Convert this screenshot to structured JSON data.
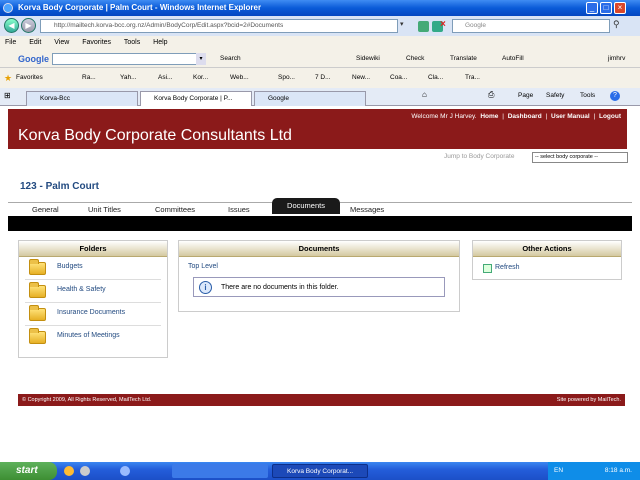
{
  "browser": {
    "window_title": "Korva Body Corporate | Palm Court - Windows Internet Explorer",
    "address": "http://mailtech.korva-bcc.org.nz/Admin/BodyCorp/Edit.aspx?bcid=2#Documents",
    "search_placeholder": "Google",
    "menu": [
      "File",
      "Edit",
      "View",
      "Favorites",
      "Tools",
      "Help"
    ],
    "google_toolbar": {
      "logo": "Google",
      "search": "Search",
      "sidewiki": "Sidewiki",
      "check": "Check",
      "translate": "Translate",
      "autofill": "AutoFill",
      "user": "jimhrv"
    },
    "favorites_label": "Favorites",
    "favorites": [
      "Ra...",
      "Yah...",
      "Asi...",
      "Kor...",
      "Web...",
      "Spo...",
      "7 D...",
      "New...",
      "Coa...",
      "Cla...",
      "Tra..."
    ],
    "tabs": [
      "Korva-Bcc",
      "Korva Body Corporate | P...",
      "Google"
    ],
    "cmd": {
      "page": "Page",
      "safety": "Safety",
      "tools": "Tools"
    }
  },
  "site": {
    "title": "Korva Body Corporate Consultants Ltd",
    "welcome": "Welcome Mr J Harvey.",
    "links": [
      "Home",
      "Dashboard",
      "User Manual",
      "Logout"
    ],
    "jump_label": "Jump to Body Corporate",
    "jump_select": "-- select body corporate --",
    "page_title": "123 - Palm Court",
    "tabs": [
      "General",
      "Unit Titles",
      "Committees",
      "Issues",
      "Documents",
      "Messages"
    ],
    "active_tab": "Documents"
  },
  "folders": {
    "header": "Folders",
    "items": [
      "Budgets",
      "Health & Safety",
      "Insurance Documents",
      "Minutes of Meetings"
    ]
  },
  "documents": {
    "header": "Documents",
    "top_level": "Top Level",
    "empty_message": "There are no documents in this folder."
  },
  "actions": {
    "header": "Other Actions",
    "refresh": "Refresh"
  },
  "footer": {
    "copyright": "© Copyright 2009, All Rights Reserved, MailTech Ltd.",
    "powered": "Site powered by MailTech."
  },
  "taskbar": {
    "start": "start",
    "task": "Korva Body Corporat...",
    "lang": "EN",
    "time": "8:18 a.m."
  },
  "colors": {
    "brand": "#8b1a1a",
    "link": "#224a80",
    "taskbar": "#245edb"
  }
}
